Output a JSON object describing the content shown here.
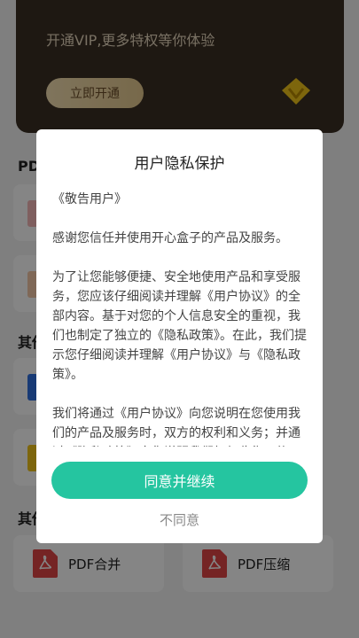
{
  "vip": {
    "subtitle": "开通VIP,更多特权等你体验",
    "open_button": "立即开通"
  },
  "sections": {
    "pdf_title": "PDF",
    "other1_title": "其他",
    "other2_title": "其他"
  },
  "tools_bottom": [
    {
      "label": "PDF合并",
      "icon": "pdf-icon"
    },
    {
      "label": "PDF压缩",
      "icon": "pdf-icon"
    }
  ],
  "dialog": {
    "title": "用户隐私保护",
    "paragraphs": [
      "《敬告用户》",
      "感谢您信任并使用开心盒子的产品及服务。",
      "为了让您能够便捷、安全地使用产品和享受服务，您应该仔细阅读并理解《用户协议》的全部内容。基于对您的个人信息安全的重视，我们也制定了独立的《隐私政策》。在此，我们提示您仔细阅读并理解《用户协议》与《隐私政策》。",
      "我们将通过《用户协议》向您说明在您使用我们的产品及服务时，双方的权利和义务；并通过《隐私政策》向您说明我们如何收集、使用、储存和分享您的个人信息，以及"
    ],
    "agree_button": "同意并继续",
    "disagree_button": "不同意"
  },
  "colors": {
    "accent": "#25c5a0",
    "vip_bg": "#3a2e24",
    "vip_gold": "#f0c419"
  }
}
